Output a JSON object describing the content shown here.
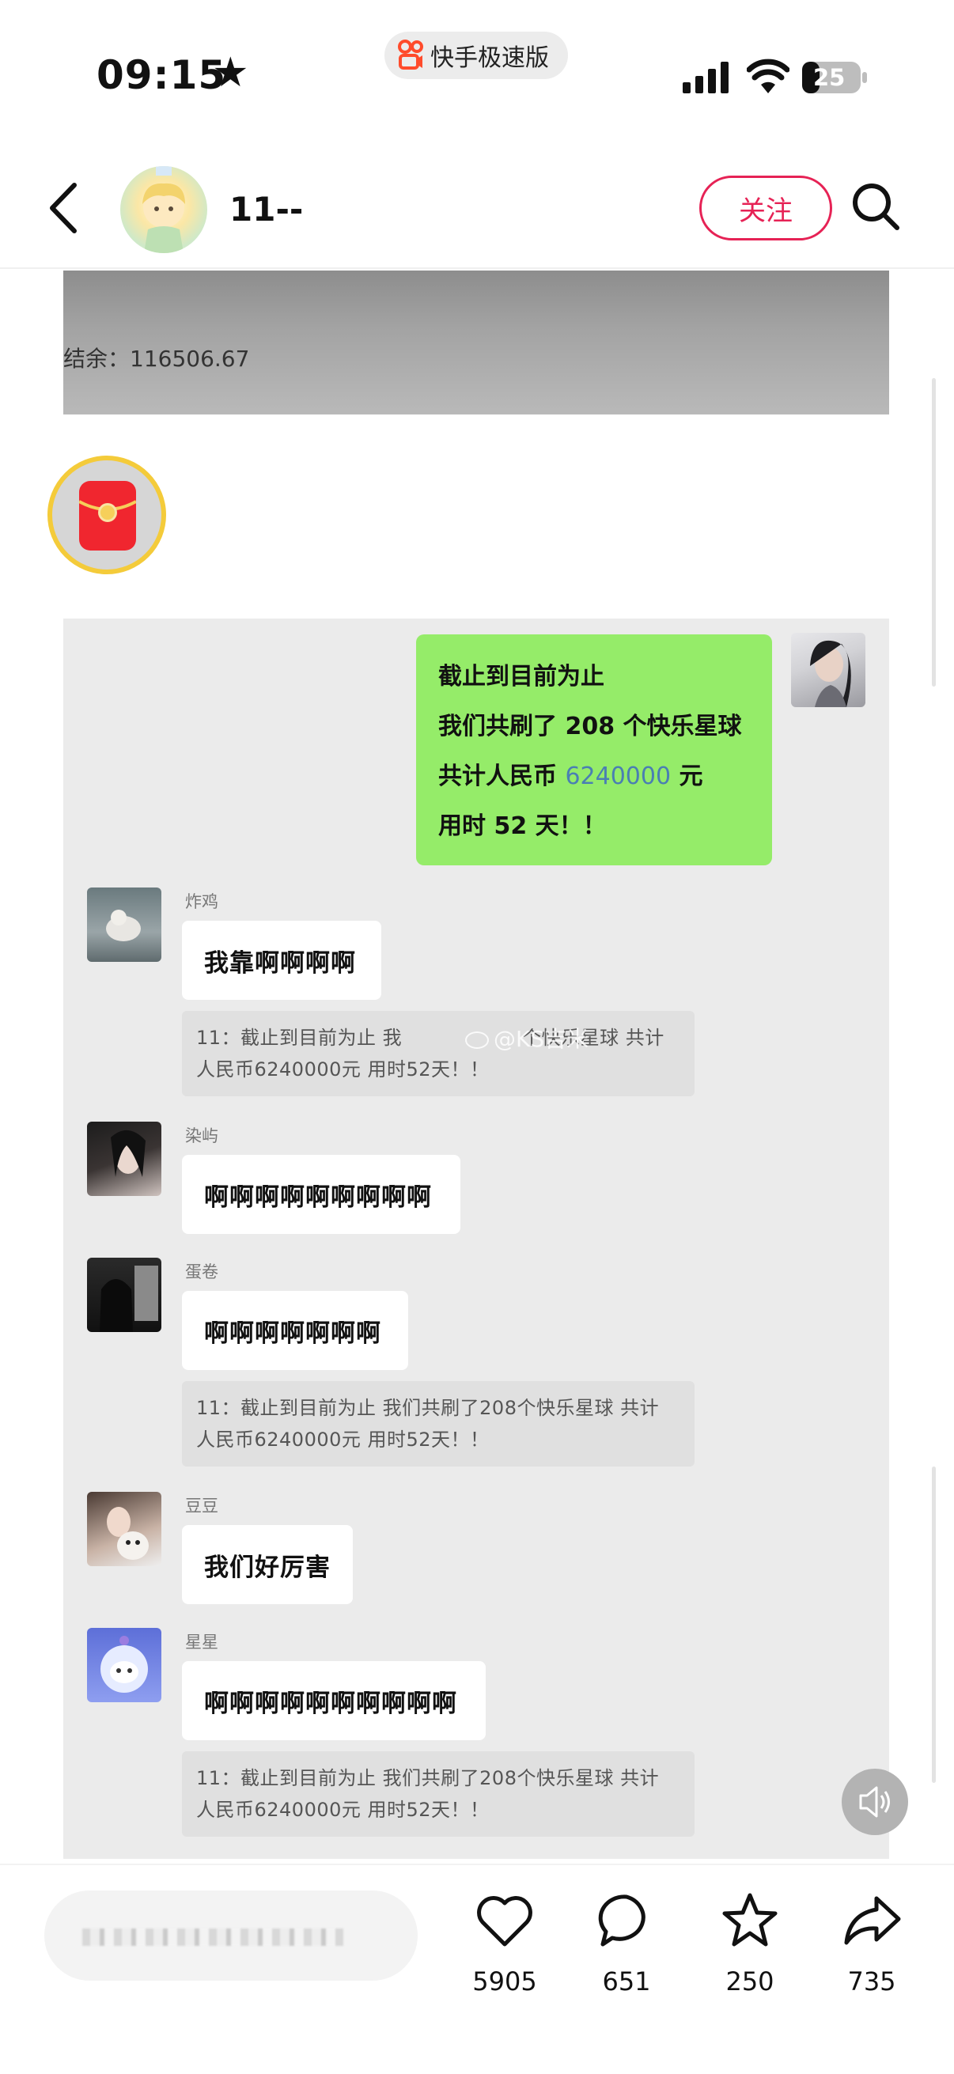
{
  "status_bar": {
    "time": "09:15",
    "app_name": "快手极速版",
    "battery": "25"
  },
  "header": {
    "username": "11--",
    "follow_label": "关注"
  },
  "photo": {
    "balance_text": "结余：116506.67"
  },
  "chat": {
    "my_message": {
      "line1": "截止到目前为止",
      "line2": "我们共刷了 208 个快乐星球",
      "line3_prefix": "共计人民币 ",
      "line3_amount": "6240000",
      "line3_suffix": " 元",
      "line4": "用时 52 天！！"
    },
    "messages": [
      {
        "sender": "炸鸡",
        "text": "我靠啊啊啊啊"
      },
      {
        "sender": "染屿",
        "text": "啊啊啊啊啊啊啊啊啊"
      },
      {
        "sender": "蛋卷",
        "text": "啊啊啊啊啊啊啊"
      },
      {
        "sender": "豆豆",
        "text": "我们好厉害"
      },
      {
        "sender": "星星",
        "text": "啊啊啊啊啊啊啊啊啊啊"
      }
    ],
    "quote_line1": "11：截止到目前为止 我们共刷了208个快乐星球 共计",
    "quote_line1_obscured": "11：截止到目前为止 我",
    "quote_line1_tail": "个快乐星球 共计",
    "quote_line2": "人民币6240000元 用时52天！！",
    "watermark": "@KS吉米"
  },
  "bottom": {
    "likes": "5905",
    "comments": "651",
    "favorites": "250",
    "shares": "735"
  },
  "icons": [
    "back-icon",
    "search-icon",
    "heart-icon",
    "comment-icon",
    "star-icon",
    "share-icon",
    "speaker-icon"
  ],
  "colors": {
    "accent": "#e62255",
    "bubble_green": "#95ec69",
    "chat_bg": "#ebebeb"
  }
}
